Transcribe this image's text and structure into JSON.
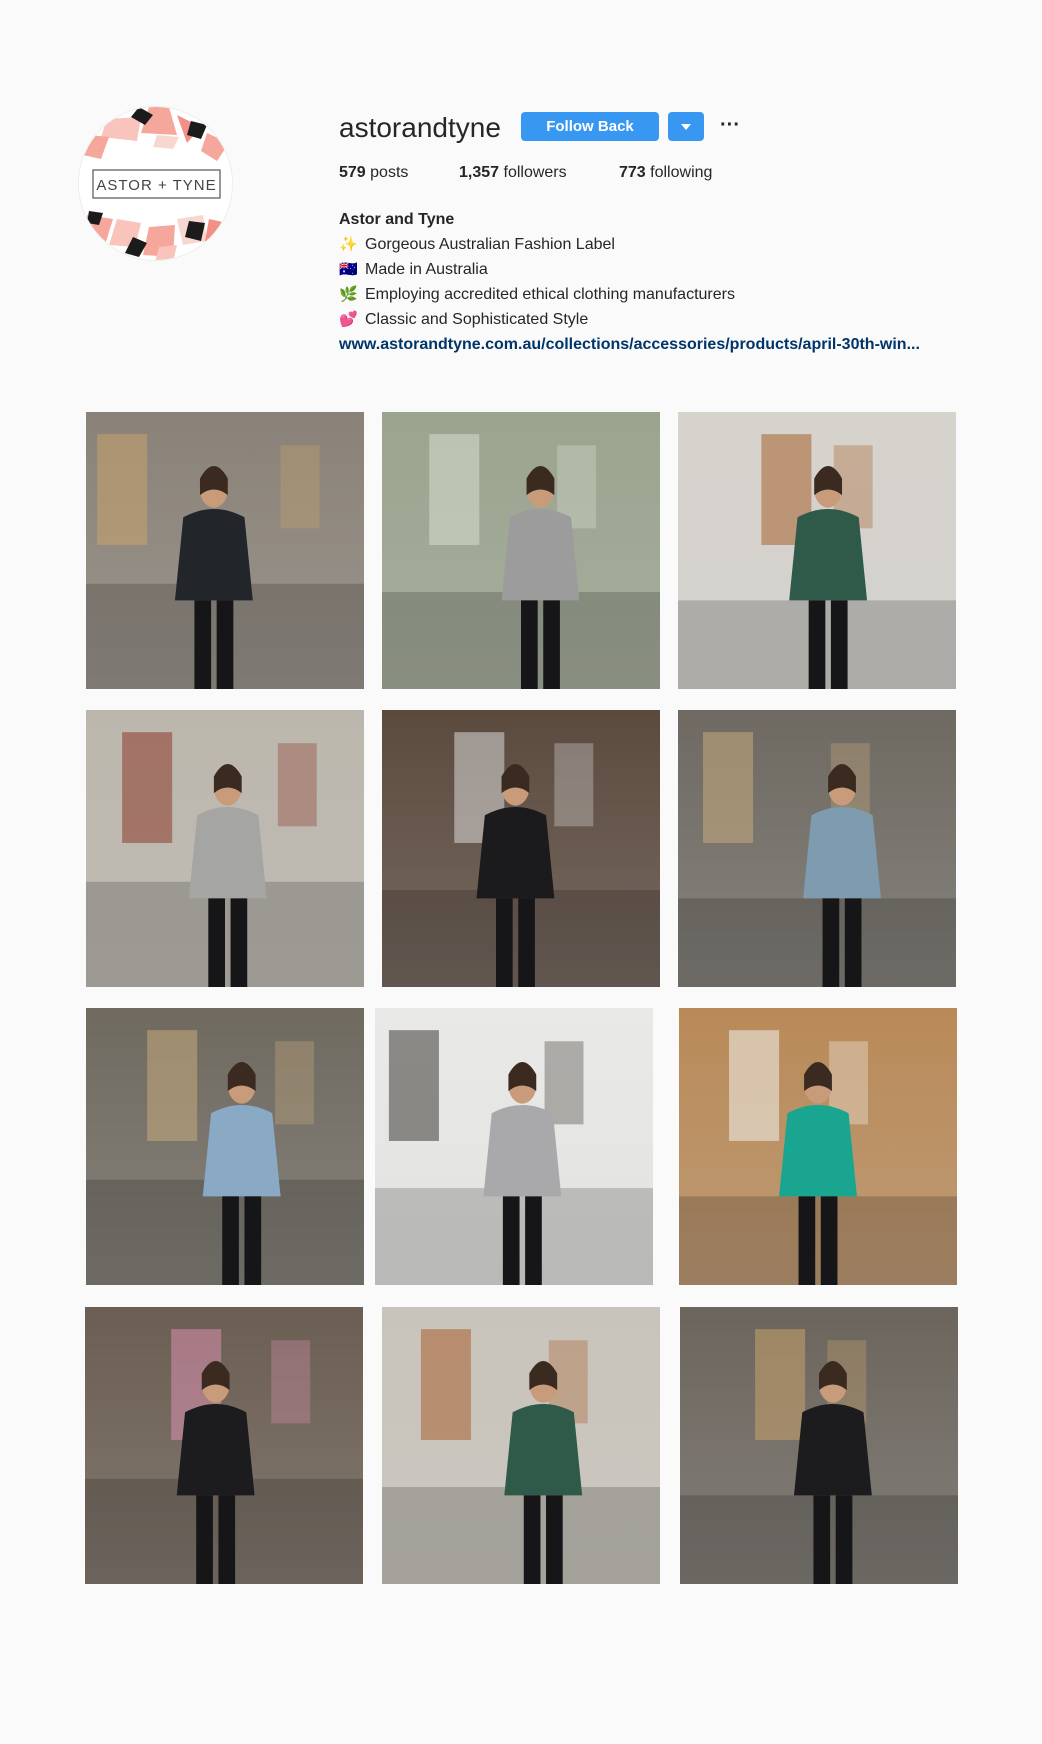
{
  "profile": {
    "username": "astorandtyne",
    "follow_label": "Follow Back",
    "more_label": "···",
    "avatar_text": "ASTOR + TYNE",
    "stats": {
      "posts_count": "579",
      "posts_label": "posts",
      "followers_count": "1,357",
      "followers_label": "followers",
      "following_count": "773",
      "following_label": "following"
    },
    "bio": {
      "name": "Astor and Tyne",
      "lines": [
        {
          "emoji": "✨",
          "text": "Gorgeous Australian Fashion Label"
        },
        {
          "emoji": "🇦🇺",
          "text": "Made in Australia"
        },
        {
          "emoji": "🌿",
          "text": "Employing accredited ethical clothing manufacturers"
        },
        {
          "emoji": "💕",
          "text": "Classic and Sophisticated Style"
        }
      ],
      "link": "www.astorandtyne.com.au/collections/accessories/products/april-30th-win..."
    }
  },
  "posts": [
    {
      "photo": "bar-interior-dark-suit",
      "bg": "#8a8278",
      "accent": "#c9a26b",
      "outfit": "#22252a"
    },
    {
      "photo": "cactus-grey-top",
      "bg": "#9aa48e",
      "accent": "#d7ddd0",
      "outfit": "#9c9c9c"
    },
    {
      "photo": "cafe-palm-print-top",
      "bg": "#d6d3cd",
      "accent": "#a8612f",
      "outfit": "#2f5a4a"
    },
    {
      "photo": "concrete-room-grey-top",
      "bg": "#bcb7ad",
      "accent": "#8c3a2c",
      "outfit": "#a5a5a3"
    },
    {
      "photo": "closeup-black-jacket",
      "bg": "#5b4a3e",
      "accent": "#d9d9d9",
      "outfit": "#1b1b1d"
    },
    {
      "photo": "window-blue-shirt",
      "bg": "#6e6a62",
      "accent": "#c7a97b",
      "outfit": "#7f9bb0"
    },
    {
      "photo": "seated-blue-shirt-coffee",
      "bg": "#6f6a60",
      "accent": "#c7a97b",
      "outfit": "#8aa9c4"
    },
    {
      "photo": "window-ledge-grey-top",
      "bg": "#e9e9e7",
      "accent": "#3c3a34",
      "outfit": "#a9a9ab"
    },
    {
      "photo": "wood-door-teal-top",
      "bg": "#b98a58",
      "accent": "#f1f0ec",
      "outfit": "#19a58f"
    },
    {
      "photo": "hallway-black-coat",
      "bg": "#6b5e52",
      "accent": "#d78fae",
      "outfit": "#1c1c1e"
    },
    {
      "photo": "counter-palm-print-seated",
      "bg": "#c9c4bb",
      "accent": "#a8612f",
      "outfit": "#2f5a4a"
    },
    {
      "photo": "dining-black-suit",
      "bg": "#6b655d",
      "accent": "#c9a26b",
      "outfit": "#1c1c1f"
    }
  ]
}
